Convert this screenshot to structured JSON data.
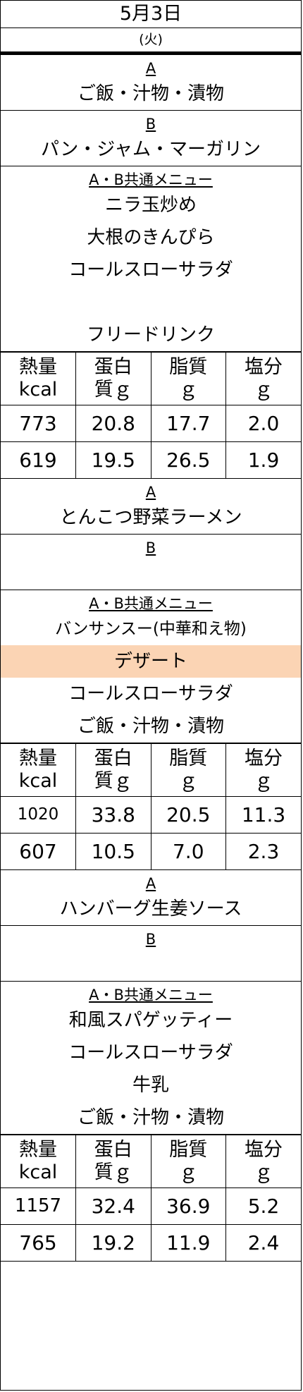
{
  "header": {
    "date": "5月3日",
    "weekday": "(火)"
  },
  "col_headers": [
    {
      "l1": "熱量",
      "l2": "kcal"
    },
    {
      "l1": "蛋白",
      "l2": "質ｇ"
    },
    {
      "l1": "脂質",
      "l2": "ｇ"
    },
    {
      "l1": "塩分",
      "l2": "ｇ"
    }
  ],
  "days": [
    {
      "a_label": "A",
      "a_items": [
        "ご飯・汁物・漬物"
      ],
      "b_label": "B",
      "b_items": [
        "パン・ジャム・マーガリン"
      ],
      "common_label": "A・B共通メニュー",
      "common_items": [
        "ニラ玉炒め",
        "大根のきんぴら",
        "コールスローサラダ",
        "",
        "フリードリンク"
      ],
      "rows": [
        [
          "773",
          "20.8",
          "17.7",
          "2.0"
        ],
        [
          "619",
          "19.5",
          "26.5",
          "1.9"
        ]
      ]
    },
    {
      "a_label": "A",
      "a_items": [
        "とんこつ野菜ラーメン"
      ],
      "b_label": "B",
      "b_items": [
        ""
      ],
      "common_label": "A・B共通メニュー",
      "common_items": [
        "バンサンスー(中華和え物)",
        "デザート",
        "コールスローサラダ",
        "ご飯・汁物・漬物"
      ],
      "rows": [
        [
          "1020",
          "33.8",
          "20.5",
          "11.3"
        ],
        [
          "607",
          "10.5",
          "7.0",
          "2.3"
        ]
      ]
    },
    {
      "a_label": "A",
      "a_items": [
        "ハンバーグ生姜ソース"
      ],
      "b_label": "B",
      "b_items": [
        ""
      ],
      "common_label": "A・B共通メニュー",
      "common_items": [
        "和風スパゲッティー",
        "コールスローサラダ",
        "牛乳",
        "ご飯・汁物・漬物"
      ],
      "rows": [
        [
          "1157",
          "32.4",
          "36.9",
          "5.2"
        ],
        [
          "765",
          "19.2",
          "11.9",
          "2.4"
        ]
      ]
    }
  ],
  "highlight_color": "#fbd4b4"
}
